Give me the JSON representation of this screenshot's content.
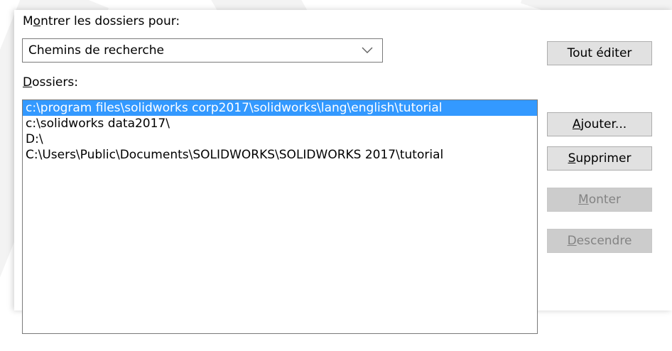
{
  "show_folders_label": {
    "before": "M",
    "mnemonic": "o",
    "after": "ntrer les dossiers pour:"
  },
  "combo": {
    "selected": "Chemins de recherche",
    "icon": "chevron-down-icon"
  },
  "folders_label": {
    "mnemonic": "D",
    "after": "ossiers:"
  },
  "folders": [
    "c:\\program files\\solidworks corp2017\\solidworks\\lang\\english\\tutorial",
    "c:\\solidworks data2017\\",
    "D:\\",
    "C:\\Users\\Public\\Documents\\SOLIDWORKS\\SOLIDWORKS 2017\\tutorial"
  ],
  "selected_index": 0,
  "buttons": {
    "edit_all": "Tout éditer",
    "add": {
      "mnemonic": "A",
      "after": "jouter..."
    },
    "remove": {
      "mnemonic": "S",
      "after": "upprimer"
    },
    "up": {
      "mnemonic": "M",
      "after": "onter"
    },
    "down": {
      "mnemonic": "D",
      "after": "escendre"
    }
  },
  "colors": {
    "selection": "#3399ff",
    "button_face": "#e1e1e1",
    "disabled_face": "#cccccc"
  }
}
